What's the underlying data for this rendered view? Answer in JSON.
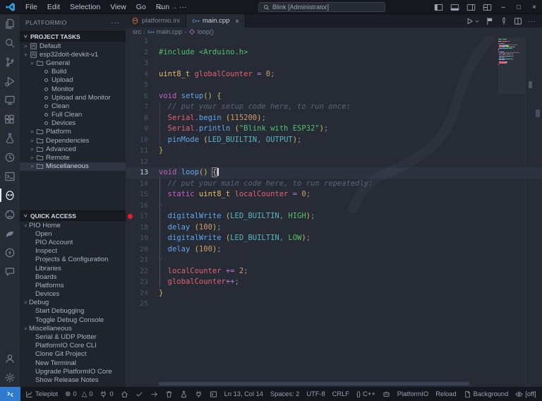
{
  "window": {
    "menus": [
      "File",
      "Edit",
      "Selection",
      "View",
      "Go",
      "Run",
      "···"
    ],
    "nav_back": "←",
    "nav_forward": "→",
    "search_title": "Blink [Administrator]",
    "controls": {
      "minimize": "–",
      "maximize": "□",
      "close": "×"
    }
  },
  "activity_bar": {
    "top": [
      {
        "name": "explorer"
      },
      {
        "name": "search"
      },
      {
        "name": "source-control"
      },
      {
        "name": "run-debug"
      },
      {
        "name": "remote-explorer"
      },
      {
        "name": "extensions"
      },
      {
        "name": "testing"
      },
      {
        "name": "timeline"
      },
      {
        "name": "terminal"
      },
      {
        "name": "platformio",
        "active": true
      },
      {
        "name": "github"
      },
      {
        "name": "teleplot"
      },
      {
        "name": "thunder-client"
      },
      {
        "name": "chat"
      }
    ],
    "bottom": [
      {
        "name": "account"
      },
      {
        "name": "settings"
      }
    ]
  },
  "sidebar": {
    "title": "PLATFORMIO",
    "more": "···",
    "sections": [
      {
        "label": "PROJECT TASKS",
        "items": [
          {
            "label": "Default",
            "level": 1,
            "chev": "right",
            "icon": "project"
          },
          {
            "label": "esp32doit-devkit-v1",
            "level": 1,
            "chev": "down",
            "icon": "project"
          },
          {
            "label": "General",
            "level": 2,
            "chev": "down",
            "icon": "folder"
          },
          {
            "label": "Build",
            "level": 3,
            "icon": "dot"
          },
          {
            "label": "Upload",
            "level": 3,
            "icon": "dot"
          },
          {
            "label": "Monitor",
            "level": 3,
            "icon": "dot"
          },
          {
            "label": "Upload and Monitor",
            "level": 3,
            "icon": "dot"
          },
          {
            "label": "Clean",
            "level": 3,
            "icon": "dot"
          },
          {
            "label": "Full Clean",
            "level": 3,
            "icon": "dot"
          },
          {
            "label": "Devices",
            "level": 3,
            "icon": "dot"
          },
          {
            "label": "Platform",
            "level": 2,
            "chev": "right",
            "icon": "folder"
          },
          {
            "label": "Dependencies",
            "level": 2,
            "chev": "right",
            "icon": "folder"
          },
          {
            "label": "Advanced",
            "level": 2,
            "chev": "right",
            "icon": "folder"
          },
          {
            "label": "Remote",
            "level": 2,
            "chev": "right",
            "icon": "folder"
          },
          {
            "label": "Miscellaneous",
            "level": 2,
            "chev": "right",
            "icon": "folder",
            "selected": true
          }
        ]
      },
      {
        "label": "QUICK ACCESS",
        "items": [
          {
            "label": "PIO Home",
            "level": 1,
            "chev": "down"
          },
          {
            "label": "Open",
            "level": 2
          },
          {
            "label": "PIO Account",
            "level": 2
          },
          {
            "label": "Inspect",
            "level": 2
          },
          {
            "label": "Projects & Configuration",
            "level": 2
          },
          {
            "label": "Libraries",
            "level": 2
          },
          {
            "label": "Boards",
            "level": 2
          },
          {
            "label": "Platforms",
            "level": 2
          },
          {
            "label": "Devices",
            "level": 2
          },
          {
            "label": "Debug",
            "level": 1,
            "chev": "down"
          },
          {
            "label": "Start Debugging",
            "level": 2
          },
          {
            "label": "Toggle Debug Console",
            "level": 2
          },
          {
            "label": "Miscellaneous",
            "level": 1,
            "chev": "down"
          },
          {
            "label": "Serial & UDP Plotter",
            "level": 2
          },
          {
            "label": "PlatformIO Core CLI",
            "level": 2
          },
          {
            "label": "Clone Git Project",
            "level": 2
          },
          {
            "label": "New Terminal",
            "level": 2
          },
          {
            "label": "Upgrade PlatformIO Core",
            "level": 2
          },
          {
            "label": "Show Release Notes",
            "level": 2
          }
        ]
      }
    ]
  },
  "editor": {
    "tabs": [
      {
        "label": "platformio.ini",
        "icon": "pio",
        "active": false
      },
      {
        "label": "main.cpp",
        "icon": "cpp",
        "active": true,
        "close": "×"
      }
    ],
    "actions": [
      {
        "name": "run"
      },
      {
        "name": "run-dropdown"
      },
      {
        "name": "flag"
      },
      {
        "name": "pin"
      },
      {
        "name": "split-editor"
      },
      {
        "name": "more",
        "label": "···"
      }
    ],
    "breadcrumb": [
      {
        "label": "src"
      },
      {
        "label": "main.cpp",
        "icon": "cpp"
      },
      {
        "label": "loop()",
        "icon": "method"
      }
    ],
    "code": {
      "lines": [
        {
          "n": 1,
          "t": []
        },
        {
          "n": 2,
          "t": [
            [
              "dir",
              "#include"
            ],
            [
              "sp",
              " "
            ],
            [
              "str",
              "<Arduino.h>"
            ]
          ]
        },
        {
          "n": 3,
          "t": []
        },
        {
          "n": 4,
          "t": [
            [
              "typ",
              "uint8_t"
            ],
            [
              "sp",
              " "
            ],
            [
              "var",
              "globalCounter"
            ],
            [
              "sp",
              " "
            ],
            [
              "op",
              "="
            ],
            [
              "sp",
              " "
            ],
            [
              "num",
              "0"
            ],
            [
              "pun",
              ";"
            ]
          ]
        },
        {
          "n": 5,
          "t": []
        },
        {
          "n": 6,
          "t": [
            [
              "kw",
              "void"
            ],
            [
              "sp",
              " "
            ],
            [
              "fn",
              "setup"
            ],
            [
              "br",
              "()"
            ],
            [
              "sp",
              " "
            ],
            [
              "br",
              "{"
            ]
          ]
        },
        {
          "n": 7,
          "t": [
            [
              "sp",
              "  "
            ],
            [
              "cmt",
              "// put your setup code here, to run once:"
            ]
          ]
        },
        {
          "n": 8,
          "t": [
            [
              "sp",
              "  "
            ],
            [
              "var",
              "Serial"
            ],
            [
              "pun",
              "."
            ],
            [
              "fn",
              "begin"
            ],
            [
              "sp",
              " "
            ],
            [
              "br",
              "("
            ],
            [
              "num",
              "115200"
            ],
            [
              "br",
              ")"
            ],
            [
              "pun",
              ";"
            ]
          ]
        },
        {
          "n": 9,
          "t": [
            [
              "sp",
              "  "
            ],
            [
              "var",
              "Serial"
            ],
            [
              "pun",
              "."
            ],
            [
              "fn",
              "println"
            ],
            [
              "sp",
              " "
            ],
            [
              "br",
              "("
            ],
            [
              "str",
              "\"Blink with ESP32\""
            ],
            [
              "br",
              ")"
            ],
            [
              "pun",
              ";"
            ]
          ]
        },
        {
          "n": 10,
          "t": [
            [
              "sp",
              "  "
            ],
            [
              "fn",
              "pinMode"
            ],
            [
              "sp",
              " "
            ],
            [
              "br",
              "("
            ],
            [
              "cst",
              "LED_BUILTIN"
            ],
            [
              "pun",
              ","
            ],
            [
              "sp",
              " "
            ],
            [
              "cst",
              "OUTPUT"
            ],
            [
              "br",
              ")"
            ],
            [
              "pun",
              ";"
            ]
          ]
        },
        {
          "n": 11,
          "t": [
            [
              "br",
              "}"
            ]
          ]
        },
        {
          "n": 12,
          "t": []
        },
        {
          "n": 13,
          "cur": true,
          "caret": true,
          "t": [
            [
              "kw",
              "void"
            ],
            [
              "sp",
              " "
            ],
            [
              "fn",
              "loop"
            ],
            [
              "br",
              "()"
            ],
            [
              "sp",
              " "
            ],
            [
              "brx",
              "{"
            ]
          ]
        },
        {
          "n": 14,
          "t": [
            [
              "sp",
              "  "
            ],
            [
              "cmt",
              "// put your main code here, to run repeatedly:"
            ]
          ]
        },
        {
          "n": 15,
          "t": [
            [
              "sp",
              "  "
            ],
            [
              "kw",
              "static"
            ],
            [
              "sp",
              " "
            ],
            [
              "typ",
              "uint8_t"
            ],
            [
              "sp",
              " "
            ],
            [
              "var",
              "localCounter"
            ],
            [
              "sp",
              " "
            ],
            [
              "op",
              "="
            ],
            [
              "sp",
              " "
            ],
            [
              "num",
              "0"
            ],
            [
              "pun",
              ";"
            ]
          ]
        },
        {
          "n": 16,
          "t": [
            [
              "ws",
              "··"
            ]
          ]
        },
        {
          "n": 17,
          "bp": true,
          "t": [
            [
              "sp",
              "  "
            ],
            [
              "fn",
              "digitalWrite"
            ],
            [
              "sp",
              " "
            ],
            [
              "br",
              "("
            ],
            [
              "cst",
              "LED_BUILTIN"
            ],
            [
              "pun",
              ","
            ],
            [
              "sp",
              " "
            ],
            [
              "enm",
              "HIGH"
            ],
            [
              "br",
              ")"
            ],
            [
              "pun",
              ";"
            ]
          ]
        },
        {
          "n": 18,
          "t": [
            [
              "sp",
              "  "
            ],
            [
              "fn",
              "delay"
            ],
            [
              "sp",
              " "
            ],
            [
              "br",
              "("
            ],
            [
              "num",
              "100"
            ],
            [
              "br",
              ")"
            ],
            [
              "pun",
              ";"
            ]
          ]
        },
        {
          "n": 19,
          "t": [
            [
              "sp",
              "  "
            ],
            [
              "fn",
              "digitalWrite"
            ],
            [
              "sp",
              " "
            ],
            [
              "br",
              "("
            ],
            [
              "cst",
              "LED_BUILTIN"
            ],
            [
              "pun",
              ","
            ],
            [
              "sp",
              " "
            ],
            [
              "enm",
              "LOW"
            ],
            [
              "br",
              ")"
            ],
            [
              "pun",
              ";"
            ]
          ]
        },
        {
          "n": 20,
          "t": [
            [
              "sp",
              "  "
            ],
            [
              "fn",
              "delay"
            ],
            [
              "sp",
              " "
            ],
            [
              "br",
              "("
            ],
            [
              "num",
              "100"
            ],
            [
              "br",
              ")"
            ],
            [
              "pun",
              ";"
            ]
          ]
        },
        {
          "n": 21,
          "t": [
            [
              "ws",
              "··"
            ]
          ]
        },
        {
          "n": 22,
          "t": [
            [
              "sp",
              "  "
            ],
            [
              "var",
              "localCounter"
            ],
            [
              "sp",
              " "
            ],
            [
              "op",
              "+="
            ],
            [
              "sp",
              " "
            ],
            [
              "num",
              "2"
            ],
            [
              "pun",
              ";"
            ]
          ]
        },
        {
          "n": 23,
          "t": [
            [
              "sp",
              "  "
            ],
            [
              "var",
              "globalCounter"
            ],
            [
              "op",
              "++"
            ],
            [
              "pun",
              ";"
            ]
          ]
        },
        {
          "n": 24,
          "t": [
            [
              "br",
              "}"
            ]
          ]
        },
        {
          "n": 25,
          "t": []
        }
      ]
    }
  },
  "status_bar": {
    "left": [
      {
        "name": "remote-indicator",
        "icon": "remote"
      },
      {
        "name": "teleplot",
        "icon": "chart",
        "label": "Teleplot"
      },
      {
        "name": "problems",
        "errors": "0",
        "warnings": "0"
      },
      {
        "name": "serial-ports",
        "icon": "plug",
        "label": "0"
      },
      {
        "name": "pio-home",
        "icon": "home"
      },
      {
        "name": "pio-build",
        "icon": "check"
      },
      {
        "name": "pio-upload",
        "icon": "arrow"
      },
      {
        "name": "pio-clean",
        "icon": "trash"
      },
      {
        "name": "pio-test",
        "icon": "flask"
      },
      {
        "name": "pio-monitor",
        "icon": "plug"
      },
      {
        "name": "pio-terminal",
        "icon": "terminal-sm"
      }
    ],
    "right": [
      {
        "name": "cursor-position",
        "label": "Ln 13, Col 14"
      },
      {
        "name": "indentation",
        "label": "Spaces: 2"
      },
      {
        "name": "encoding",
        "label": "UTF-8"
      },
      {
        "name": "eol",
        "label": "CRLF"
      },
      {
        "name": "language-mode",
        "icon": "braces",
        "label": "C++"
      },
      {
        "name": "robot",
        "icon": "robot"
      },
      {
        "name": "platformio-status",
        "label": "PlatformIO"
      },
      {
        "name": "reload",
        "label": "Reload"
      },
      {
        "name": "background-task",
        "icon": "file",
        "label": "Background"
      },
      {
        "name": "teleplot-toggle",
        "icon": "eye",
        "label": "[off]"
      },
      {
        "name": "notifications",
        "icon": "bell"
      }
    ]
  }
}
